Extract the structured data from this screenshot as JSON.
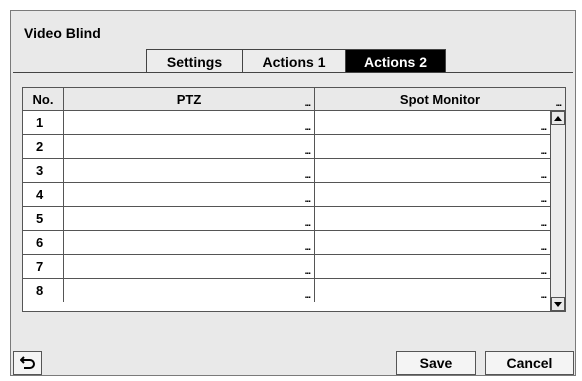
{
  "dialog": {
    "title": "Video Blind"
  },
  "tabs": [
    {
      "label": "Settings",
      "active": false
    },
    {
      "label": "Actions 1",
      "active": false
    },
    {
      "label": "Actions 2",
      "active": true
    }
  ],
  "table": {
    "headers": [
      "No.",
      "PTZ",
      "Spot Monitor"
    ],
    "ellipsis": "...",
    "rows": [
      {
        "no": "1",
        "ptz": "",
        "spot": ""
      },
      {
        "no": "2",
        "ptz": "",
        "spot": ""
      },
      {
        "no": "3",
        "ptz": "",
        "spot": ""
      },
      {
        "no": "4",
        "ptz": "",
        "spot": ""
      },
      {
        "no": "5",
        "ptz": "",
        "spot": ""
      },
      {
        "no": "6",
        "ptz": "",
        "spot": ""
      },
      {
        "no": "7",
        "ptz": "",
        "spot": ""
      },
      {
        "no": "8",
        "ptz": "",
        "spot": ""
      }
    ]
  },
  "footer": {
    "back_icon": "back-arrow-icon",
    "save_label": "Save",
    "cancel_label": "Cancel"
  }
}
